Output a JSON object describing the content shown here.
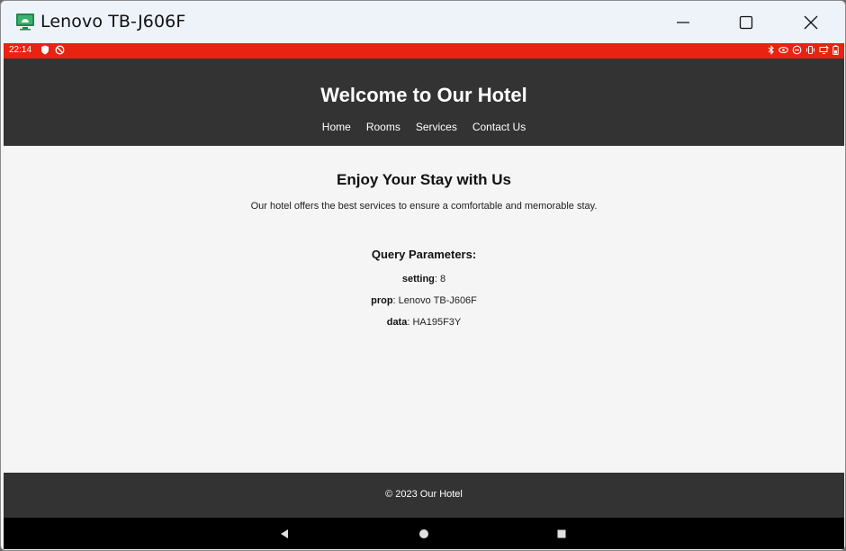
{
  "window": {
    "title": "Lenovo TB-J606F",
    "icon": "android-monitor-icon",
    "controls": [
      "minimize-icon",
      "maximize-icon",
      "close-icon"
    ]
  },
  "statusbar": {
    "time": "22:14",
    "bg_color": "#e8230f"
  },
  "site": {
    "header_title": "Welcome to Our Hotel",
    "nav": [
      {
        "label": "Home"
      },
      {
        "label": "Rooms"
      },
      {
        "label": "Services"
      },
      {
        "label": "Contact Us"
      }
    ],
    "main_heading": "Enjoy Your Stay with Us",
    "main_text": "Our hotel offers the best services to ensure a comfortable and memorable stay.",
    "query_heading": "Query Parameters:",
    "params": [
      {
        "key": "setting",
        "value": ": 8"
      },
      {
        "key": "prop",
        "value": ": Lenovo TB-J606F"
      },
      {
        "key": "data",
        "value": ": HA195F3Y"
      }
    ],
    "footer_text": "© 2023 Our Hotel",
    "header_color": "#333333"
  },
  "navbar": {
    "keys": [
      "back-icon",
      "home-icon",
      "recents-icon"
    ]
  }
}
